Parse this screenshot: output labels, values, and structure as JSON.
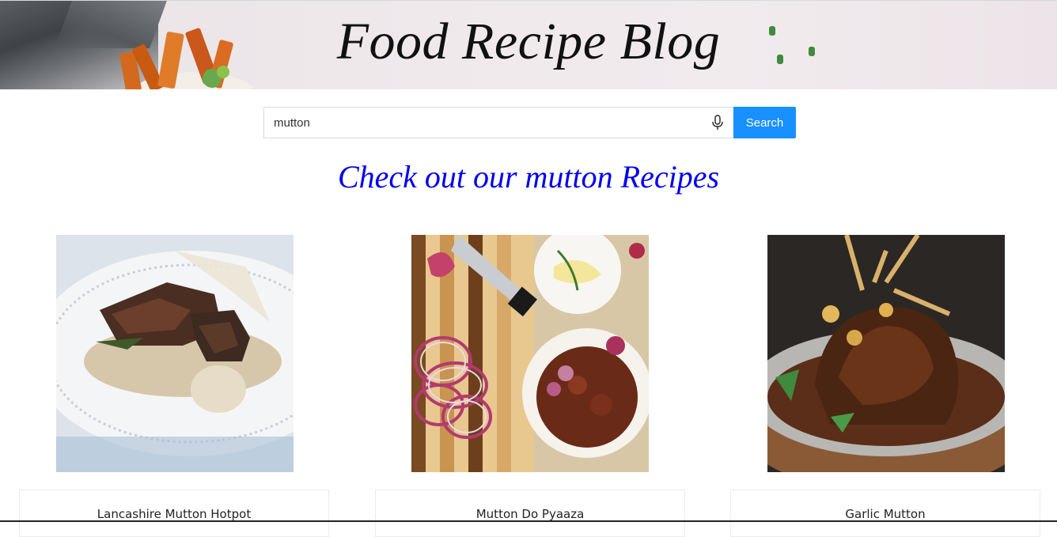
{
  "header": {
    "title": "Food Recipe Blog"
  },
  "search": {
    "value": "mutton",
    "placeholder": "",
    "button_label": "Search",
    "mic_icon": "microphone-icon"
  },
  "heading": "Check out our mutton Recipes",
  "recipes": [
    {
      "title": "Lancashire Mutton Hotpot"
    },
    {
      "title": "Mutton Do Pyaaza"
    },
    {
      "title": "Garlic Mutton"
    }
  ],
  "colors": {
    "accent": "#1890ff",
    "heading": "#0000ee"
  }
}
